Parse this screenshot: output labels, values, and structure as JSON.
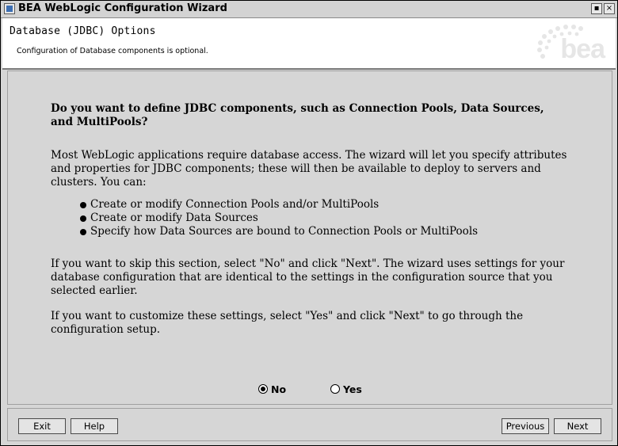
{
  "window": {
    "title": "BEA WebLogic Configuration Wizard",
    "minimize_glyph": "▪",
    "close_glyph": "×"
  },
  "header": {
    "title": "Database (JDBC) Options",
    "subtitle": "Configuration of Database components is optional.",
    "logo_text": "bea"
  },
  "content": {
    "question": "Do you want to define JDBC components, such as Connection Pools, Data Sources, and MultiPools?",
    "intro": "Most WebLogic applications require database access.  The wizard will let you specify attributes and properties for JDBC components; these will then be available to deploy to servers and clusters. You can:",
    "bullets": [
      "Create or modify Connection Pools and/or MultiPools",
      "Create or modify Data Sources",
      "Specify how Data Sources are bound to Connection Pools or MultiPools"
    ],
    "skip_text": "If you want to skip this section, select \"No\" and click \"Next\". The wizard uses settings for your database configuration that are identical to the settings in the configuration source that you selected earlier.",
    "customize_text": "If you want to customize these settings, select \"Yes\" and click \"Next\" to go through the configuration setup."
  },
  "options": {
    "selected": "No",
    "no_label": "No",
    "yes_label": "Yes"
  },
  "footer": {
    "exit_label": "Exit",
    "help_label": "Help",
    "previous_label": "Previous",
    "next_label": "Next"
  },
  "colors": {
    "background": "#d6d6d6",
    "header_background": "#ffffff",
    "text": "#000000"
  }
}
